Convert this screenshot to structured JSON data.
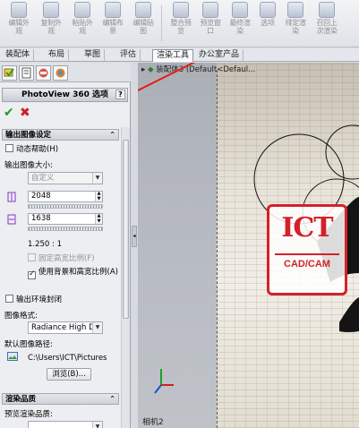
{
  "toolbar": {
    "buttons": [
      {
        "label": "编辑外\n观"
      },
      {
        "label": "复制外\n观"
      },
      {
        "label": "粘贴外\n观"
      },
      {
        "label": "编辑布\n景"
      },
      {
        "label": "编辑贴\n图"
      },
      {
        "label": "整合预\n览"
      },
      {
        "label": "预览窗\n口"
      },
      {
        "label": "最终渲\n染"
      },
      {
        "label": "选项"
      },
      {
        "label": "排定渲\n染"
      },
      {
        "label": "召回上\n次渲染"
      }
    ]
  },
  "command_tabs": [
    "装配体",
    "布局",
    "草图",
    "评估",
    "渲染工具",
    "办公室产品"
  ],
  "command_tabs_active": "渲染工具",
  "property_manager": {
    "title": "PhotoView 360 选项",
    "help": "?",
    "ok": "✔",
    "cancel": "✖",
    "output_group": {
      "title": "输出图像设定",
      "dynamic_help": "动态帮助(H)",
      "output_size_label": "输出图像大小:",
      "size_preset": "自定义",
      "width": "2048",
      "height": "1638",
      "aspect": "1.250 : 1",
      "fixed_aspect": "固定高宽比例(F)",
      "use_background_aspect": "使用背景和高宽比例(A)",
      "output_env_closure": "输出环境封闭",
      "image_format_label": "图像格式:",
      "image_format": "Radiance High Dy",
      "default_path_label": "默认图像路径:",
      "default_path": "C:\\Users\\ICT\\Pictures",
      "browse": "浏览(B)..."
    },
    "render_quality_group": {
      "title": "渲染品质",
      "preview_quality_label": "预览渲染品质:"
    }
  },
  "viewport": {
    "tree_item": "装配体3  (Default<Defaul...",
    "camera_label": "相机2",
    "logo_text": "ICT",
    "logo_sub": "CAD/CAM"
  }
}
